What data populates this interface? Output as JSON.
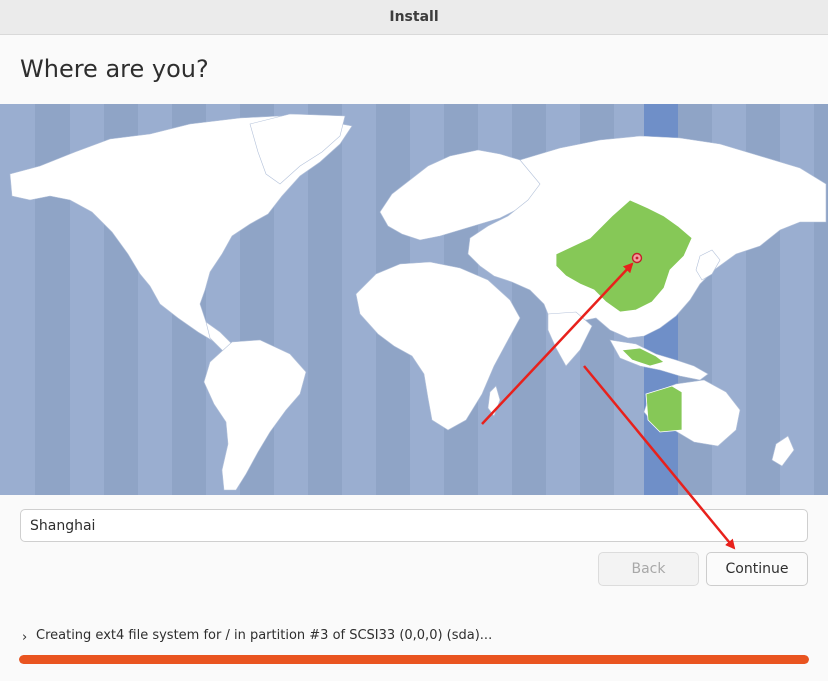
{
  "window": {
    "title": "Install"
  },
  "page": {
    "heading": "Where are you?"
  },
  "map": {
    "selected_city": "Shanghai",
    "selected_zone_color": "#86c857",
    "ocean_color": "#8fa4c6",
    "land_color": "#ffffff",
    "selected_band_color": "#6f8fc8"
  },
  "location": {
    "value": "Shanghai"
  },
  "buttons": {
    "back_label": "Back",
    "continue_label": "Continue"
  },
  "status": {
    "message": "Creating ext4 file system for / in partition #3 of SCSI33 (0,0,0) (sda)...",
    "progress": 1.0,
    "progress_color": "#e95420"
  },
  "annotation": {
    "arrow_color": "#e8211c"
  }
}
